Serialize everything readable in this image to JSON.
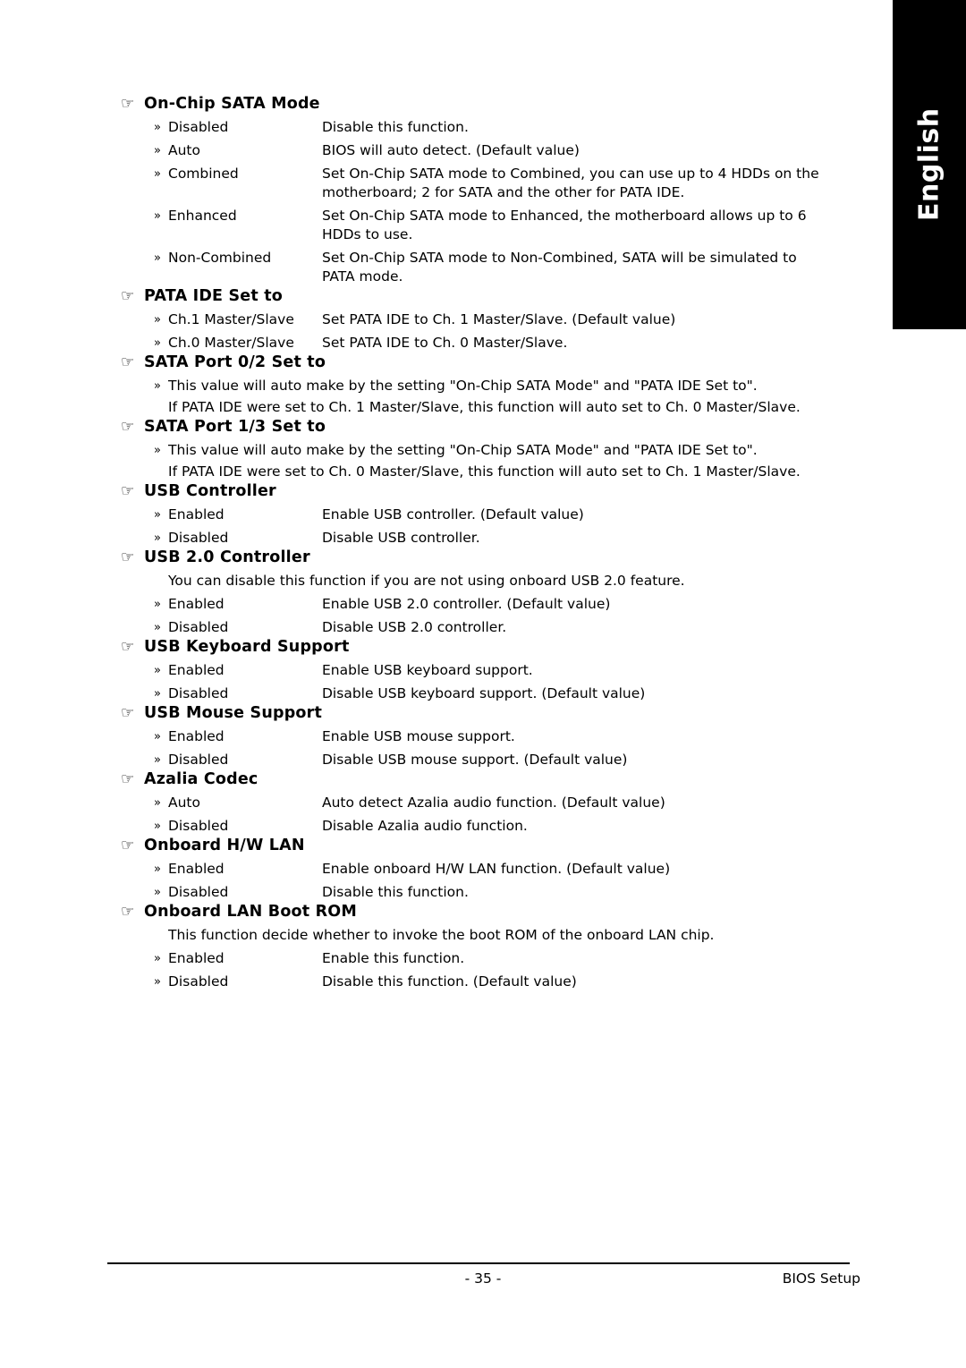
{
  "side_tab": {
    "label": "English"
  },
  "footer": {
    "page_number": "- 35 -",
    "right_label": "BIOS Setup"
  },
  "icons": {
    "heading_pointer": "☞",
    "option_bullet": "»"
  },
  "sections": [
    {
      "title": "On-Chip SATA Mode",
      "options": [
        {
          "label": "Disabled",
          "desc": "Disable this function.",
          "desc2": ""
        },
        {
          "label": "Auto",
          "desc": "BIOS will auto detect. (Default value)",
          "desc2": ""
        },
        {
          "label": "Combined",
          "desc": "Set On-Chip SATA mode to Combined, you can use up to 4 HDDs on the",
          "desc2": "motherboard; 2 for SATA and the other for PATA IDE."
        },
        {
          "label": "Enhanced",
          "desc": "Set On-Chip SATA mode to Enhanced, the motherboard allows up to 6",
          "desc2": "HDDs to use."
        },
        {
          "label": "Non-Combined",
          "desc": "Set On-Chip SATA mode to Non-Combined, SATA will be simulated to",
          "desc2": "PATA mode."
        }
      ],
      "notes": [],
      "plain": []
    },
    {
      "title": "PATA IDE Set to",
      "options": [
        {
          "label": "Ch.1 Master/Slave",
          "desc": "Set PATA IDE to Ch. 1 Master/Slave. (Default value)",
          "desc2": ""
        },
        {
          "label": "Ch.0 Master/Slave",
          "desc": "Set PATA IDE to Ch. 0 Master/Slave.",
          "desc2": ""
        }
      ],
      "notes": [],
      "plain": []
    },
    {
      "title": "SATA Port 0/2 Set to",
      "options": [],
      "notes": [
        "This value will auto make by the setting \"On-Chip SATA Mode\" and \"PATA IDE Set to\"."
      ],
      "plain": [
        "If PATA IDE were set to Ch. 1 Master/Slave, this function will auto set to Ch. 0 Master/Slave."
      ]
    },
    {
      "title": "SATA Port 1/3 Set to",
      "options": [],
      "notes": [
        "This value will auto make by the setting \"On-Chip SATA Mode\" and \"PATA IDE Set to\"."
      ],
      "plain": [
        "If PATA IDE were set to Ch. 0 Master/Slave, this function will auto set to Ch. 1 Master/Slave."
      ]
    },
    {
      "title": "USB Controller",
      "options": [
        {
          "label": "Enabled",
          "desc": "Enable USB controller. (Default value)",
          "desc2": ""
        },
        {
          "label": "Disabled",
          "desc": "Disable USB controller.",
          "desc2": ""
        }
      ],
      "notes": [],
      "plain": []
    },
    {
      "title": "USB 2.0 Controller",
      "intro": "You can disable this function if you are not using onboard USB 2.0 feature.",
      "options": [
        {
          "label": "Enabled",
          "desc": "Enable USB 2.0 controller. (Default value)",
          "desc2": ""
        },
        {
          "label": "Disabled",
          "desc": "Disable USB 2.0 controller.",
          "desc2": ""
        }
      ],
      "notes": [],
      "plain": []
    },
    {
      "title": "USB Keyboard Support",
      "options": [
        {
          "label": "Enabled",
          "desc": "Enable USB keyboard support.",
          "desc2": ""
        },
        {
          "label": "Disabled",
          "desc": "Disable USB keyboard support. (Default value)",
          "desc2": ""
        }
      ],
      "notes": [],
      "plain": []
    },
    {
      "title": "USB Mouse Support",
      "options": [
        {
          "label": "Enabled",
          "desc": "Enable USB mouse support.",
          "desc2": ""
        },
        {
          "label": "Disabled",
          "desc": "Disable USB mouse support. (Default value)",
          "desc2": ""
        }
      ],
      "notes": [],
      "plain": []
    },
    {
      "title": "Azalia Codec",
      "options": [
        {
          "label": "Auto",
          "desc": "Auto detect Azalia audio function. (Default value)",
          "desc2": ""
        },
        {
          "label": "Disabled",
          "desc": "Disable Azalia audio function.",
          "desc2": ""
        }
      ],
      "notes": [],
      "plain": []
    },
    {
      "title": "Onboard H/W LAN",
      "options": [
        {
          "label": "Enabled",
          "desc": "Enable onboard H/W LAN function. (Default value)",
          "desc2": ""
        },
        {
          "label": "Disabled",
          "desc": "Disable this function.",
          "desc2": ""
        }
      ],
      "notes": [],
      "plain": []
    },
    {
      "title": "Onboard LAN Boot ROM",
      "intro": "This function decide whether to invoke the boot ROM of the onboard LAN chip.",
      "options": [
        {
          "label": "Enabled",
          "desc": "Enable this function.",
          "desc2": ""
        },
        {
          "label": "Disabled",
          "desc": "Disable this function. (Default value)",
          "desc2": ""
        }
      ],
      "notes": [],
      "plain": []
    }
  ]
}
